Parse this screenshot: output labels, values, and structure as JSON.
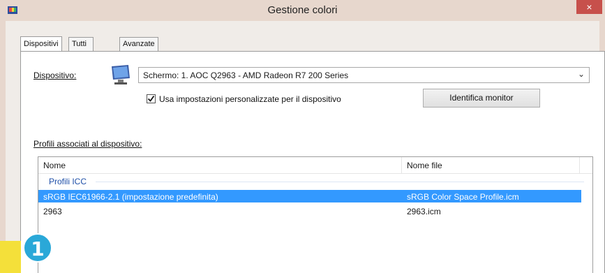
{
  "window": {
    "title": "Gestione colori",
    "close_label": "×"
  },
  "tabs": [
    {
      "label": "Dispositivi"
    },
    {
      "label": "Tutti i profili"
    },
    {
      "label": "Avanzate"
    }
  ],
  "device": {
    "label": "Dispositivo:",
    "selected": "Schermo: 1. AOC Q2963 - AMD Radeon R7 200 Series",
    "checkbox_label": "Usa impostazioni personalizzate per il dispositivo",
    "checkbox_checked": true,
    "identify_button": "Identifica monitor"
  },
  "profiles": {
    "section_label": "Profili associati al dispositivo:",
    "columns": [
      "Nome",
      "Nome file"
    ],
    "group": "Profili ICC",
    "rows": [
      {
        "name": "sRGB IEC61966-2.1 (impostazione predefinita)",
        "file": "sRGB Color Space Profile.icm",
        "selected": true
      },
      {
        "name": "2963",
        "file": "2963.icm",
        "selected": false
      }
    ]
  },
  "marker": {
    "number": "1"
  },
  "colors": {
    "selection": "#3399ff",
    "group_text": "#1e4fa8",
    "marker": "#2aa8d8",
    "highlight": "#f4e03a",
    "close": "#c7504b"
  }
}
